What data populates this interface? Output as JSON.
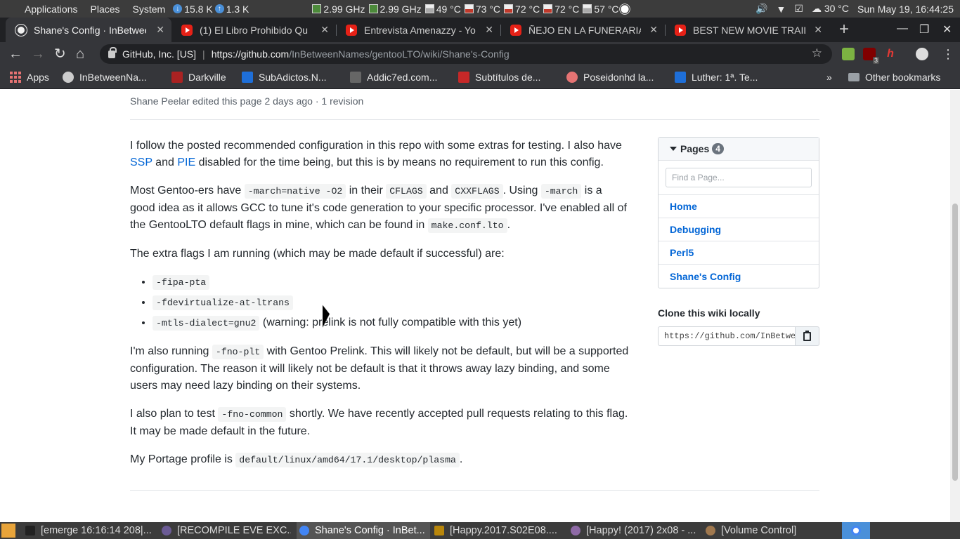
{
  "system_panel": {
    "menus": [
      "Applications",
      "Places",
      "System"
    ],
    "net_down": "15.8 K",
    "net_up": "1.3 K",
    "cpu_freqs": [
      "2.99 GHz",
      "2.99 GHz"
    ],
    "temps": [
      "49 °C",
      "73 °C",
      "72 °C",
      "72 °C",
      "57 °C"
    ],
    "weather_temp": "30 °C",
    "datetime": "Sun May 19, 16:44:25"
  },
  "tabs": [
    {
      "label": "Shane's Config · InBetwee",
      "icon": "github-icon",
      "active": true
    },
    {
      "label": "(1) El Libro Prohibido Qu",
      "icon": "youtube-icon",
      "active": false
    },
    {
      "label": "Entrevista Amenazzy - Yo",
      "icon": "youtube-icon",
      "active": false
    },
    {
      "label": "ÑEJO EN LA FUNERARIA",
      "icon": "youtube-icon",
      "active": false
    },
    {
      "label": "BEST NEW MOVIE TRAILE",
      "icon": "youtube-icon",
      "active": false
    }
  ],
  "address_bar": {
    "org": "GitHub, Inc. [US]",
    "url_host": "https://github.com",
    "url_path": "/InBetweenNames/gentooLTO/wiki/Shane's-Config"
  },
  "extensions": [
    {
      "name": "extension-icon",
      "badge": ""
    },
    {
      "name": "ublock-icon",
      "badge": "3"
    },
    {
      "name": "h-extension-icon",
      "badge": ""
    }
  ],
  "bookmarks": {
    "apps": "Apps",
    "items": [
      "InBetweenNa...",
      "Darkville",
      "SubAdictos.N...",
      "Addic7ed.com...",
      "Subtítulos de...",
      "Poseidonhd la...",
      "Luther: 1ª. Te..."
    ],
    "overflow": "»",
    "other": "Other bookmarks"
  },
  "page": {
    "edit_meta": "Shane Peelar edited this page 2 days ago · 1 revision",
    "p1_a": "I follow the posted recommended configuration in this repo with some extras for testing. I also have ",
    "p1_link1": "SSP",
    "p1_b": " and ",
    "p1_link2": "PIE",
    "p1_c": " disabled for the time being, but this is by means no requirement to run this config.",
    "p2_a": "Most Gentoo-ers have ",
    "p2_code1": "-march=native -O2",
    "p2_b": " in their ",
    "p2_code2": "CFLAGS",
    "p2_c": " and ",
    "p2_code3": "CXXFLAGS",
    "p2_d": ". Using ",
    "p2_code4": "-march",
    "p2_e": " is a good idea as it allows GCC to tune it's code generation to your specific processor. I've enabled all of the GentooLTO default flags in mine, which can be found in ",
    "p2_code5": "make.conf.lto",
    "p2_f": ".",
    "p3": "The extra flags I am running (which may be made default if successful) are:",
    "flags": [
      "-fipa-pta",
      "-fdevirtualize-at-ltrans",
      "-mtls-dialect=gnu2"
    ],
    "flag3_note": " (warning: prelink is not fully compatible with this yet)",
    "p4_a": "I'm also running ",
    "p4_code": "-fno-plt",
    "p4_b": " with Gentoo Prelink. This will likely not be default, but will be a supported configuration. The reason it will likely not be default is that it throws away lazy binding, and some users may need lazy binding on their systems.",
    "p5_a": "I also plan to test ",
    "p5_code": "-fno-common",
    "p5_b": " shortly. We have recently accepted pull requests relating to this flag. It may be made default in the future.",
    "p6_a": "My Portage profile is ",
    "p6_code": "default/linux/amd64/17.1/desktop/plasma",
    "p6_b": "."
  },
  "sidebar": {
    "pages_title": "Pages",
    "pages_count": "4",
    "search_placeholder": "Find a Page...",
    "pages": [
      "Home",
      "Debugging",
      "Perl5",
      "Shane's Config"
    ],
    "clone_title": "Clone this wiki locally",
    "clone_url": "https://github.com/InBetweenNames/gentooLTO.wiki.git"
  },
  "taskbar": {
    "items": [
      "[emerge 16:16:14 208|...",
      "[RECOMPILE EVE EXC...",
      "Shane's Config · InBet...",
      "[Happy.2017.S02E08....",
      "[Happy! (2017) 2x08 - ...",
      "[Volume Control]"
    ]
  },
  "colors": {
    "link": "#0366d6",
    "chrome_dark": "#35363a",
    "panel": "#3c3c3c"
  }
}
